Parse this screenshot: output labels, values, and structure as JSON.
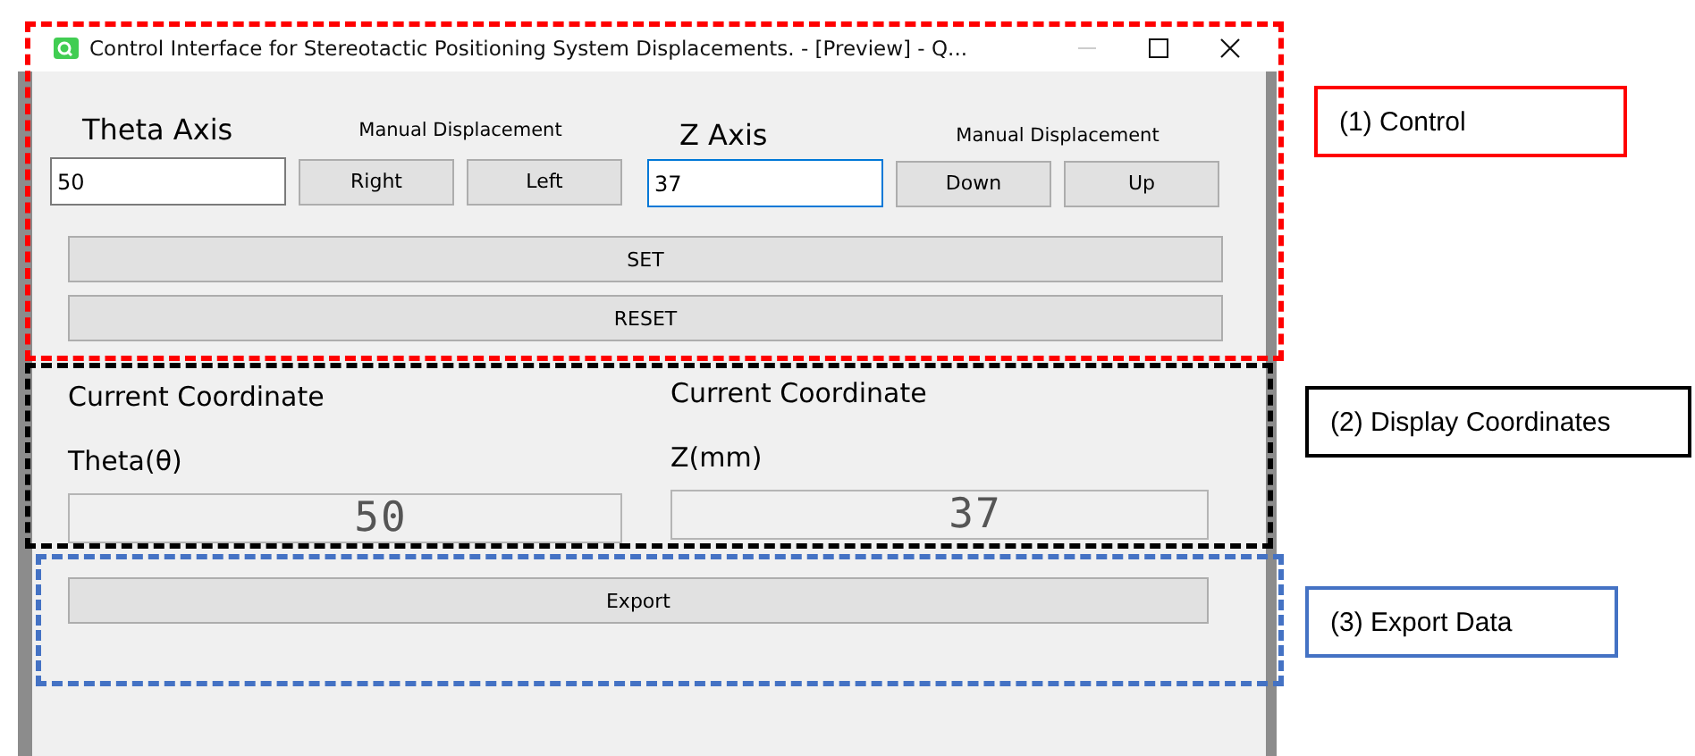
{
  "window": {
    "title": "Control Interface for Stereotactic Positioning System Displacements. - [Preview] - Q..."
  },
  "control": {
    "axes": [
      {
        "heading": "Theta Axis",
        "manual_label": "Manual Displacement",
        "value": "50",
        "focused": false,
        "buttons": [
          "Right",
          "Left"
        ]
      },
      {
        "heading": "Z Axis",
        "manual_label": "Manual Displacement",
        "value": "37",
        "focused": true,
        "buttons": [
          "Down",
          "Up"
        ]
      }
    ],
    "set_button": "SET",
    "reset_button": "RESET"
  },
  "display": [
    {
      "heading": "Current Coordinate",
      "axis_label": "Theta(θ)",
      "reading": "50"
    },
    {
      "heading": "Current Coordinate",
      "axis_label": "Z(mm)",
      "reading": "37"
    }
  ],
  "export_button": "Export",
  "annotations": [
    {
      "label": "(1) Control",
      "color": "#ff0000"
    },
    {
      "label": "(2) Display Coordinates",
      "color": "#000000"
    },
    {
      "label": "(3) Export Data",
      "color": "#4472c4"
    }
  ]
}
